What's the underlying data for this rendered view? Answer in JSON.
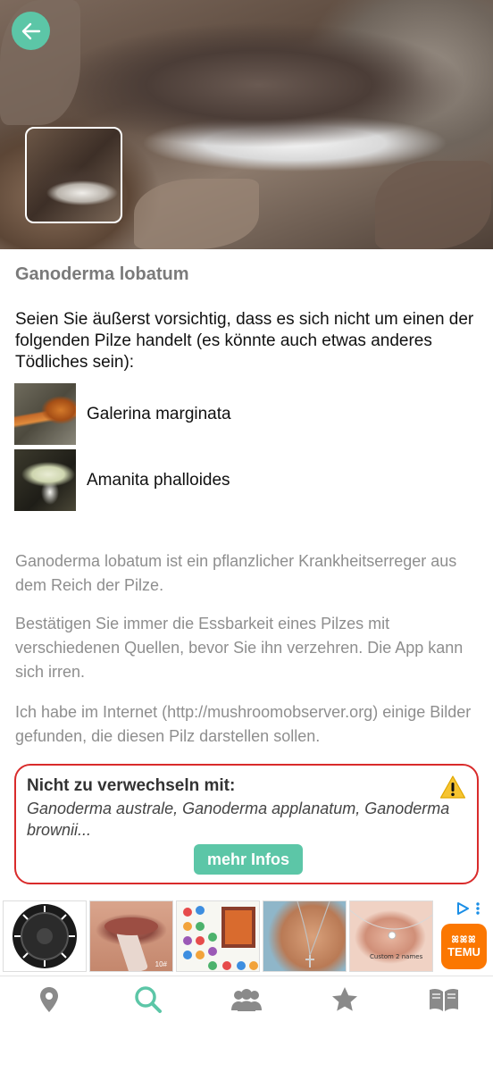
{
  "colors": {
    "accent": "#5cc6a7",
    "warning_border": "#d92b2b",
    "text_muted": "#8e8e8e",
    "temu": "#fb7701"
  },
  "header": {
    "back_icon": "arrow-left-icon"
  },
  "mushroom": {
    "name": "Ganoderma lobatum"
  },
  "warning_text": "Seien Sie äußerst vorsichtig, dass es sich nicht um einen der folgenden Pilze handelt (es könnte auch etwas anderes Tödliches sein):",
  "lookalikes": [
    {
      "name": "Galerina marginata"
    },
    {
      "name": "Amanita phalloides"
    }
  ],
  "paragraphs": [
    "Ganoderma lobatum ist ein pflanzlicher Krankheitserreger aus dem Reich der Pilze.",
    "Bestätigen Sie immer die Essbarkeit eines Pilzes mit verschiedenen Quellen, bevor Sie ihn verzehren. Die App kann sich irren.",
    "Ich habe im Internet (http://mushroomobserver.org) einige Bilder gefunden, die diesen Pilz darstellen sollen."
  ],
  "confusion": {
    "title": "Nicht zu verwechseln mit:",
    "species": "Ganoderma australe, Ganoderma applanatum, Ganoderma brownii...",
    "button_label": "mehr Infos",
    "icon": "warning-triangle-icon"
  },
  "ads": {
    "items": [
      "wheel-product-ad",
      "lipstick-product-ad",
      "sticker-sheet-ad",
      "necklace-ad",
      "finger-necklace-ad"
    ],
    "lipstick_caption": "10#",
    "necklace_caption": "Custom 2 names",
    "brand_logo_text": "TEMU",
    "brand_logo_top": "ꕤꕤꕤ"
  },
  "tabbar": {
    "tabs": [
      {
        "icon": "map-pin-icon",
        "active": false
      },
      {
        "icon": "search-icon",
        "active": true
      },
      {
        "icon": "community-icon",
        "active": false
      },
      {
        "icon": "star-icon",
        "active": false
      },
      {
        "icon": "book-icon",
        "active": false
      }
    ]
  }
}
